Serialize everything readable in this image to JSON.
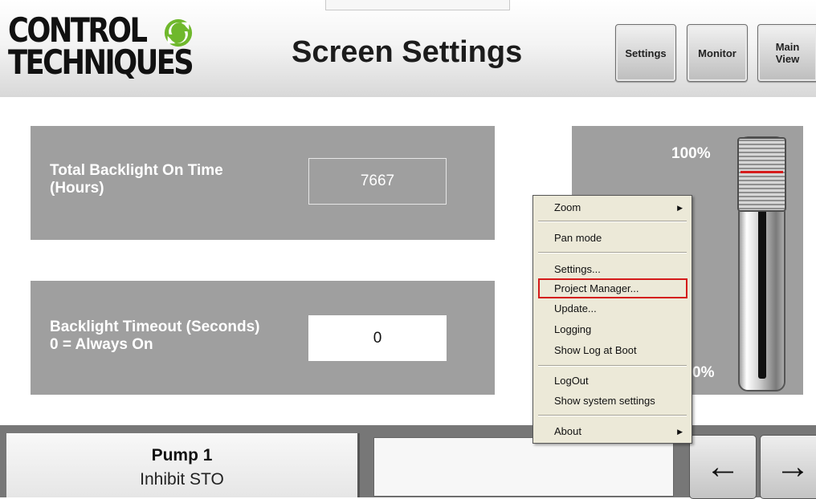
{
  "header": {
    "logo": {
      "line1": "CONTROL",
      "line2": "TECHNIQUES"
    },
    "title": "Screen Settings",
    "nav": {
      "settings": "Settings",
      "monitor": "Monitor",
      "main_view": "Main\nView"
    }
  },
  "backlight_time": {
    "label": "Total Backlight On Time\n(Hours)",
    "value": "7667"
  },
  "backlight_timeout": {
    "label": "Backlight Timeout (Seconds)\n0 = Always On",
    "value": "0"
  },
  "brightness_slider": {
    "max_label": "100%",
    "min_label": "0%",
    "level": 0.95
  },
  "context_menu": {
    "items": [
      {
        "label": "Zoom",
        "submenu": true
      },
      {
        "label": "Pan mode"
      },
      {
        "label": "Settings..."
      },
      {
        "label": "Project Manager...",
        "highlighted": true
      },
      {
        "label": "Update..."
      },
      {
        "label": "Logging"
      },
      {
        "label": "Show Log at Boot"
      },
      {
        "label": "LogOut"
      },
      {
        "label": "Show system settings"
      },
      {
        "label": "About",
        "submenu": true
      }
    ]
  },
  "footer": {
    "pump_name": "Pump 1",
    "pump_status": "Inhibit STO",
    "status_text": "",
    "back_icon": "arrow-left-icon",
    "forward_icon": "arrow-right-icon"
  },
  "colors": {
    "panel": "#9f9f9f",
    "highlight_border": "#d41a1a",
    "menu_bg": "#ece9d8",
    "slider_mark": "#d61c1c"
  }
}
